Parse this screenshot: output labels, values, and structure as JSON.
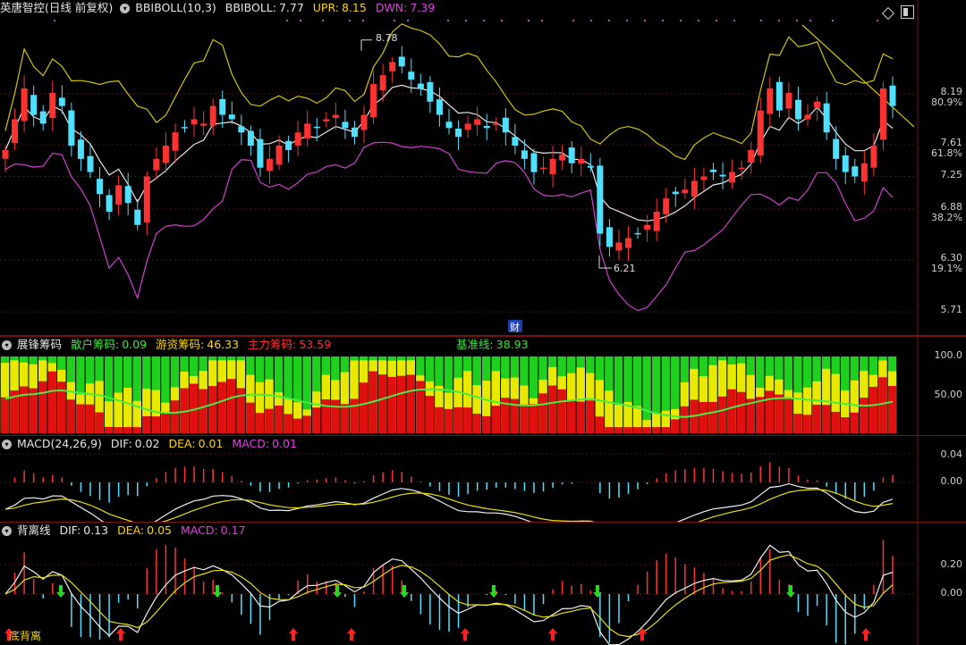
{
  "main": {
    "stock_name": "英唐智控",
    "period": "(日线 前复权)",
    "indicator": "BBIBOLL(10,3)",
    "bbiboll_label": "BBIBOLL:",
    "bbiboll_value": "7.77",
    "upr_label": "UPR:",
    "upr_value": "8.15",
    "dwn_label": "DWN:",
    "dwn_value": "7.39",
    "high_label": "8.78",
    "low_label": "6.21",
    "cai_label": "财",
    "y_ticks": [
      {
        "label": "8.19",
        "pct": "80.9%",
        "v": 8.19
      },
      {
        "label": "7.61",
        "pct": "61.8%",
        "v": 7.61
      },
      {
        "label": "7.25",
        "pct": "",
        "v": 7.25
      },
      {
        "label": "6.88",
        "pct": "38.2%",
        "v": 6.88
      },
      {
        "label": "6.30",
        "pct": "19.1%",
        "v": 6.3
      },
      {
        "label": "5.71",
        "pct": "",
        "v": 5.71
      }
    ]
  },
  "chip": {
    "title": "展锋筹码",
    "retail_label": "散户筹码:",
    "retail_value": "0.09",
    "hot_label": "游资筹码:",
    "hot_value": "46.33",
    "main_label": "主力筹码:",
    "main_value": "53.59",
    "base_label": "基准线:",
    "base_value": "38.93",
    "y_ticks": [
      "100.0",
      "50.00"
    ]
  },
  "macd": {
    "title": "MACD(24,26,9)",
    "dif_label": "DIF:",
    "dif_value": "0.02",
    "dea_label": "DEA:",
    "dea_value": "0.01",
    "macd_label": "MACD:",
    "macd_value": "0.01",
    "y_ticks": [
      "0.04",
      "0.00"
    ]
  },
  "div": {
    "title": "背离线",
    "dif_label": "DIF:",
    "dif_value": "0.13",
    "dea_label": "DEA:",
    "dea_value": "0.05",
    "macd_label": "MACD:",
    "macd_value": "0.17",
    "bottom_label": "底背离",
    "y_ticks": [
      "0.20",
      "0.00"
    ]
  },
  "colors": {
    "up": "#ff3232",
    "down": "#4fe0ff",
    "upr": "#d4c400",
    "mid": "#e8e8e8",
    "dwn": "#d040d0",
    "chip_green": "#1fd01f",
    "chip_yellow": "#e8e800",
    "chip_red": "#e01010",
    "base": "#44ee44"
  },
  "chart_data": {
    "type": "candlestick",
    "ylim": [
      5.71,
      8.78
    ],
    "high": 8.78,
    "low": 6.21,
    "last_close": 8.05,
    "closes": [
      7.55,
      7.9,
      8.25,
      7.95,
      7.85,
      8.2,
      8.05,
      7.6,
      7.45,
      7.3,
      7.05,
      6.85,
      7.15,
      6.95,
      6.7,
      7.25,
      7.45,
      7.6,
      7.75,
      7.8,
      7.9,
      7.85,
      8.05,
      7.95,
      7.9,
      7.75,
      7.6,
      7.35,
      7.45,
      7.6,
      7.55,
      7.75,
      7.85,
      7.8,
      7.9,
      7.95,
      7.8,
      7.7,
      7.95,
      8.3,
      8.4,
      8.55,
      8.5,
      8.35,
      8.25,
      8.1,
      7.95,
      7.8,
      7.7,
      7.85,
      7.9,
      7.8,
      7.85,
      7.75,
      7.6,
      7.45,
      7.3,
      7.35,
      7.45,
      7.5,
      7.4,
      7.45,
      7.35,
      6.6,
      6.45,
      6.5,
      6.55,
      6.6,
      6.7,
      6.85,
      7.0,
      7.05,
      7.1,
      7.2,
      7.25,
      7.3,
      7.25,
      7.3,
      7.35,
      7.55,
      8.0,
      8.25,
      8.0,
      8.2,
      7.9,
      7.95,
      8.1,
      7.75,
      7.45,
      7.3,
      7.25,
      7.4,
      7.6,
      8.25,
      8.05
    ]
  }
}
